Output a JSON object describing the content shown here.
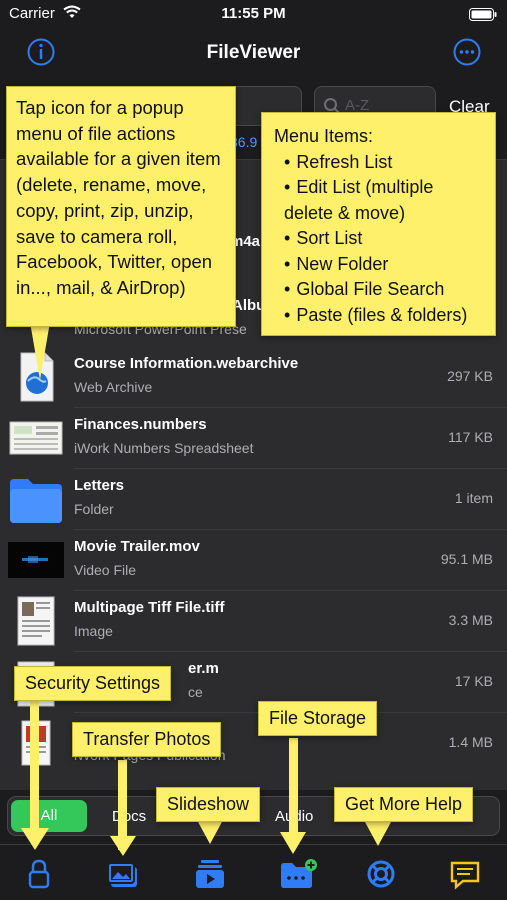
{
  "status": {
    "carrier": "Carrier",
    "time": "11:55 PM"
  },
  "nav": {
    "title": "FileViewer"
  },
  "search": {
    "placeholder": "A-Z",
    "clear_label": "Clear",
    "peek_size": "36.9"
  },
  "files": [
    {
      "name": "Course Information.webarchive",
      "type": "Web Archive",
      "size": "297 KB",
      "icon": "webarchive-icon"
    },
    {
      "name": "Finances.numbers",
      "type": "iWork Numbers Spreadsheet",
      "size": "117 KB",
      "icon": "spreadsheet-icon"
    },
    {
      "name": "Letters",
      "type": "Folder",
      "size": "1 item",
      "icon": "folder-icon"
    },
    {
      "name": "Movie Trailer.mov",
      "type": "Video File",
      "size": "95.1 MB",
      "icon": "video-icon"
    },
    {
      "name": "Multipage Tiff File.tiff",
      "type": "Image",
      "size": "3.3 MB",
      "icon": "tiff-icon"
    }
  ],
  "partial_rows": {
    "ppt_name": "Albu",
    "ppt_type": "Microsoft PowerPoint Prese",
    "m4a_name": "m4a",
    "objc_name": "er.m",
    "objc_type": "ce",
    "objc_size": "17 KB",
    "pages_type": "iWork Pages Publication",
    "pages_size": "1.4 MB"
  },
  "callouts": {
    "actions_tip": "Tap icon for a popup menu of file actions available for a given item (delete, rename, move, copy, print, zip, unzip, save to camera roll, Facebook, Twitter, open in..., mail, & AirDrop)",
    "menu_title": "Menu Items:",
    "menu_items": [
      "Refresh List",
      "Edit List (multiple delete & move)",
      "Sort List",
      "New Folder",
      "Global File Search",
      "Paste (files & folders)"
    ],
    "security_settings": "Security Settings",
    "transfer_photos": "Transfer Photos",
    "file_storage": "File Storage",
    "slideshow": "Slideshow",
    "get_more_help": "Get More Help"
  },
  "filter": {
    "active": "All",
    "options": [
      "Docs",
      "Audio"
    ]
  },
  "colors": {
    "accent_blue": "#2f7cf6",
    "active_green": "#34c759",
    "callout_yellow": "#fff06b",
    "tab_yellow": "#f5c518"
  }
}
